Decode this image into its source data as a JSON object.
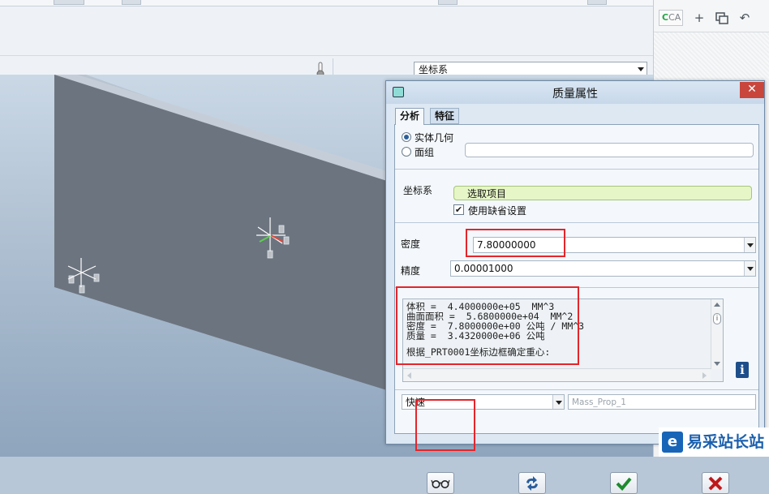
{
  "app": {
    "coordinate_dropdown": {
      "value": "坐标系"
    },
    "right_panel": {
      "cad_label": "CA"
    }
  },
  "dialog": {
    "title": "质量属性",
    "tabs": [
      {
        "label": "分析",
        "active": true
      },
      {
        "label": "特征",
        "active": false
      }
    ],
    "geometry_options": [
      {
        "label": "实体几何",
        "selected": true
      },
      {
        "label": "面组",
        "selected": false
      }
    ],
    "quilt_field": {
      "value": ""
    },
    "coordinate_system": {
      "label": "坐标系",
      "select_value": "选取项目",
      "use_default_label": "使用缺省设置",
      "use_default_checked": true
    },
    "density": {
      "label": "密度",
      "value": "7.80000000"
    },
    "accuracy": {
      "label": "精度",
      "value": "0.00001000"
    },
    "results": {
      "lines": [
        "体积 =  4.4000000e+05  MM^3",
        "曲面面积 =  5.6800000e+04  MM^2",
        "密度 =  7.8000000e+00 公吨 / MM^3",
        "质量 =  3.4320000e+06 公吨",
        "",
        "根据_PRT0001坐标边框确定重心:"
      ]
    },
    "mode_dropdown": {
      "value": "快速"
    },
    "name_field": {
      "value": "Mass_Prop_1"
    },
    "buttons": [
      {
        "name": "preview",
        "icon": "glasses-icon"
      },
      {
        "name": "repaint",
        "icon": "regenerate-icon"
      },
      {
        "name": "ok",
        "icon": "check-icon",
        "color": "#1e8a2e"
      },
      {
        "name": "cancel",
        "icon": "cross-icon",
        "color": "#c0171a"
      }
    ]
  },
  "watermark": {
    "logo_char": "e",
    "text": "易采站长站"
  },
  "colors": {
    "highlight": "#e4252b",
    "dialog_bg": "#dbe7f4",
    "model_face": "#6c747f"
  }
}
